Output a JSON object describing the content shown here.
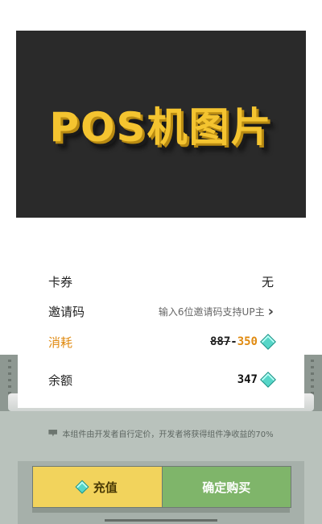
{
  "banner": {
    "text": "POS机图片"
  },
  "rows": {
    "coupon": {
      "label": "卡券",
      "value": "无"
    },
    "invite": {
      "label": "邀请码",
      "hint": "输入6位邀请码支持UP主",
      "chevron": "›"
    },
    "cost": {
      "label": "消耗",
      "old_price": "887",
      "dash": "-",
      "new_price": "350",
      "currency_icon": "diamond-icon"
    },
    "balance": {
      "label": "余额",
      "value": "347",
      "currency_icon": "diamond-icon"
    }
  },
  "notice": {
    "text": "本组件由开发者自行定价，开发者将获得组件净收益的70%"
  },
  "buttons": {
    "recharge": "充值",
    "buy": "确定购买"
  },
  "colors": {
    "accent": "#e08a10",
    "recharge_bg": "#f2d35c",
    "buy_bg": "#7fb56a",
    "banner_text": "#f4c430"
  }
}
